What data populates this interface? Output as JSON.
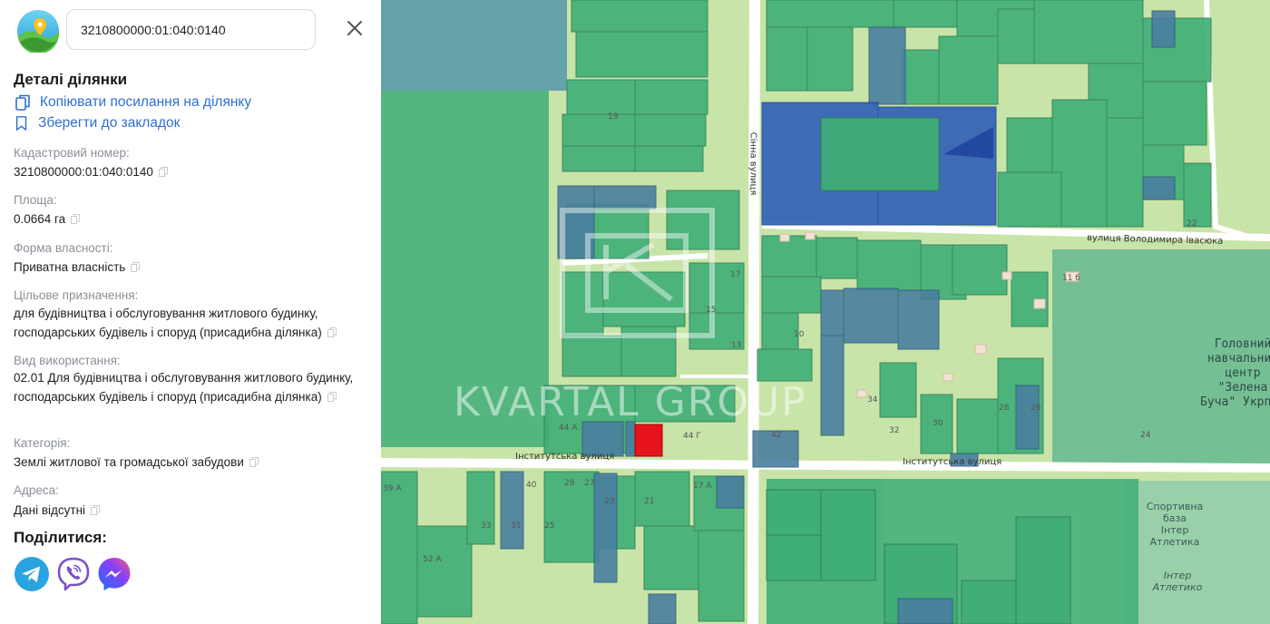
{
  "search": {
    "value": "3210800000:01:040:0140"
  },
  "details": {
    "title": "Деталі ділянки",
    "copy_link_label": "Копіювати посилання на ділянку",
    "bookmark_label": "Зберегти до закладок"
  },
  "fields": {
    "cadastral_label": "Кадастровий номер:",
    "cadastral_value": "3210800000:01:040:0140",
    "area_label": "Площа:",
    "area_value": "0.0664 га",
    "ownership_label": "Форма власності:",
    "ownership_value": "Приватна власність",
    "purpose_label": "Цільове призначення:",
    "purpose_value": "для будівництва і обслуговування житлового будинку, господарських будівель і споруд (присадибна ділянка)",
    "usage_label": "Вид використання:",
    "usage_value": "02.01 Для будівництва і обслуговування житлового будинку, господарських будівель і споруд (присадибна ділянка)",
    "category_label": "Категорія:",
    "category_value": "Землі житлової та громадської забудови",
    "address_label": "Адреса:",
    "address_value": "Дані відсутні"
  },
  "share": {
    "title": "Поділитися:",
    "icons": [
      "telegram-icon",
      "viber-icon",
      "messenger-icon"
    ]
  },
  "map": {
    "watermark": "KVARTAL GROUP",
    "streets": {
      "instytutska_1": "Інститутська вулиця",
      "instytutska_2": "Інститутська вулиця",
      "ivasiuka": "вулиця Володимира Івасюка",
      "sinna": "Сінна вулиця"
    },
    "poi": {
      "center_l1": "Головний",
      "center_l2": "навчальний",
      "center_l3": "центр",
      "center_l4": "\"Зелена",
      "center_l5": "Буча\" Укрпош",
      "sport_l1": "Спортивна",
      "sport_l2": "база",
      "sport_l3": "Інтер",
      "sport_l4": "Атлетика",
      "inter_l1": "Інтер",
      "inter_l2": "Атлетико"
    },
    "house_numbers": {
      "n19": "19",
      "n17": "17",
      "n15": "15",
      "n13": "13",
      "n10": "10",
      "n44a": "44 А",
      "n44g": "44 Г",
      "n34": "34",
      "n32": "32",
      "n30": "30",
      "n28": "28",
      "n26": "26",
      "n24": "24",
      "n22": "22",
      "n116": "11 б",
      "n39a": "39 А",
      "n33": "33",
      "n31": "31",
      "n29": "29",
      "n27": "27",
      "n25": "25",
      "n17a": "17 А",
      "n42": "42",
      "n23": "23",
      "n40": "40",
      "n52a": "52 А",
      "n21": "21"
    },
    "colors": {
      "land": "#c9e4a8",
      "parcel_green": "#3fae77",
      "parcel_blue": "#4a7fa0",
      "parcel_darkblue": "#2e5fb8",
      "selected": "#e8141b",
      "road": "#ffffff"
    }
  },
  "colors": {
    "accent": "#2f6fd6",
    "label_gray": "#8b9099"
  }
}
